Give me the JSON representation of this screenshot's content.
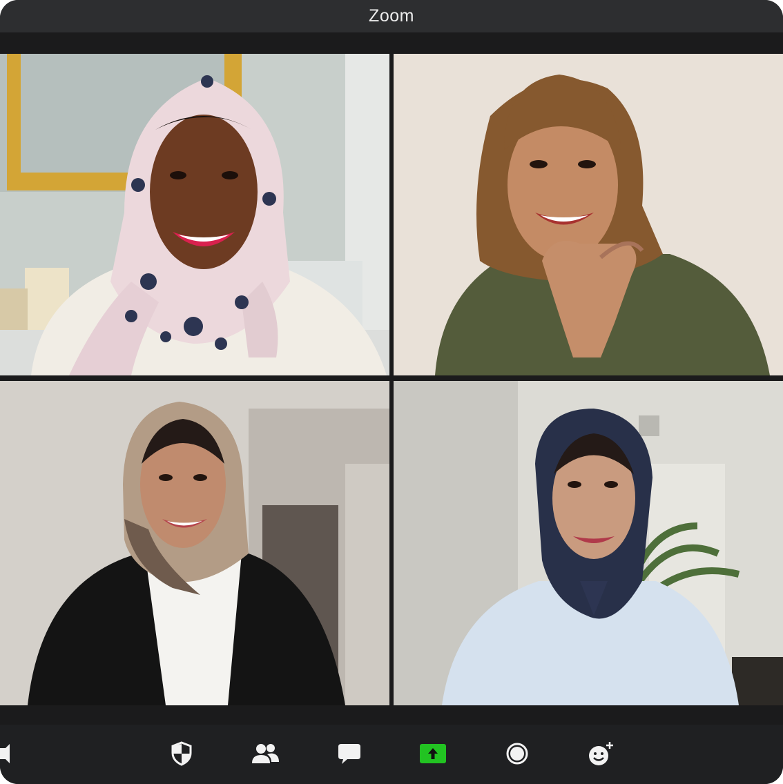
{
  "window": {
    "title": "Zoom"
  },
  "participants": [
    {
      "id": "p1",
      "scarf_color": "#efd9dd",
      "clothing_color": "#f3efe8",
      "background_color": "#c9d0cc"
    },
    {
      "id": "p2",
      "scarf_color": "#8a5e33",
      "clothing_color": "#545c3d",
      "background_color": "#eae2d8"
    },
    {
      "id": "p3",
      "scarf_color": "#b9a28e",
      "clothing_color": "#151515",
      "background_color": "#d4d0cb"
    },
    {
      "id": "p4",
      "scarf_color": "#2a3148",
      "clothing_color": "#d6e1ee",
      "background_color": "#dcdbd6"
    }
  ],
  "toolbar": {
    "items": [
      {
        "name": "mute-icon",
        "icon": "speaker"
      },
      {
        "name": "security-icon",
        "icon": "shield"
      },
      {
        "name": "participants-icon",
        "icon": "people"
      },
      {
        "name": "chat-icon",
        "icon": "speech-bubble"
      },
      {
        "name": "share-screen-icon",
        "icon": "green-arrow-up"
      },
      {
        "name": "record-icon",
        "icon": "circle"
      },
      {
        "name": "reactions-icon",
        "icon": "smiley-plus"
      }
    ],
    "share_color": "#22c322",
    "icon_color": "#f2f2f2"
  }
}
